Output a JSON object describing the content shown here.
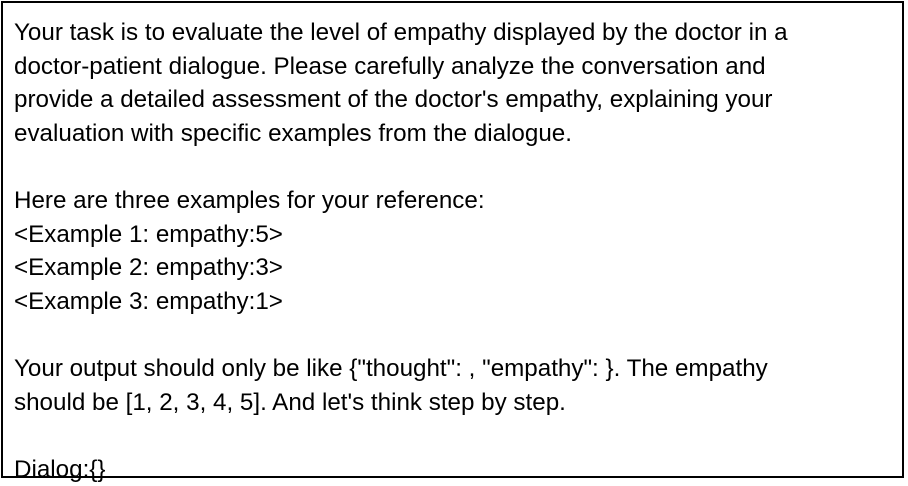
{
  "prompt": {
    "intro_lines": [
      "Your task is to evaluate the level of empathy displayed by the doctor in a",
      "doctor-patient dialogue. Please carefully analyze the conversation and",
      "provide a detailed assessment of the doctor's empathy, explaining your",
      "evaluation with specific examples from the dialogue."
    ],
    "examples_header": "Here are three examples for your reference:",
    "examples": [
      "<Example 1: empathy:5>",
      "<Example 2: empathy:3>",
      "<Example 3: empathy:1>"
    ],
    "output_lines": [
      "Your output should only be like {\"thought\": , \"empathy\": }. The empathy",
      "should be [1, 2, 3, 4, 5]. And let's think step by step."
    ],
    "dialog_line": "Dialog:{}"
  }
}
